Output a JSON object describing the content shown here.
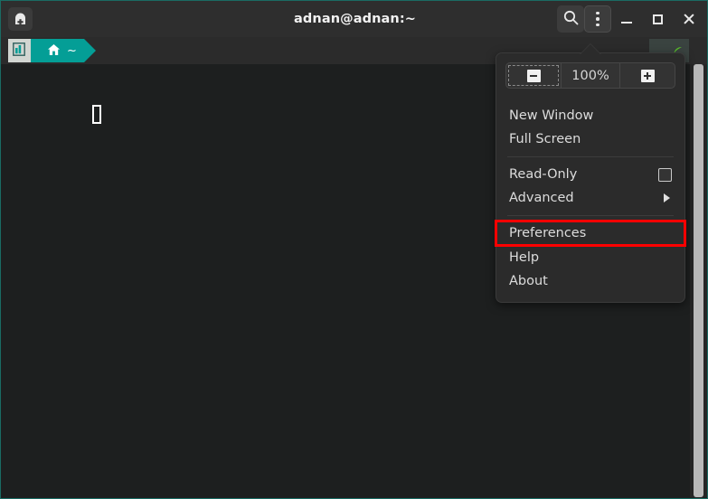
{
  "window": {
    "title": "adnan@adnan:~",
    "accent_border": "#1a6b63",
    "background": "#1d1f1f"
  },
  "titlebar": {
    "new_tab_button": "new-tab",
    "search_button": "search",
    "menu_button": "menu",
    "minimize_button": "minimize",
    "maximize_button": "maximize",
    "close_button": "close"
  },
  "tabbar": {
    "tab": {
      "icon": "chart-bars-icon",
      "home_icon": "home-icon",
      "label": "~"
    }
  },
  "terminal": {
    "prompt_text": "",
    "cursor": "block-cursor"
  },
  "menu": {
    "zoom": {
      "out_label": "zoom-out",
      "level": "100%",
      "in_label": "zoom-in"
    },
    "items": [
      {
        "label": "New Window",
        "type": "plain"
      },
      {
        "label": "Full Screen",
        "type": "plain"
      },
      {
        "label": "Read-Only",
        "type": "checkbox",
        "checked": false
      },
      {
        "label": "Advanced",
        "type": "submenu"
      },
      {
        "label": "Preferences",
        "type": "plain",
        "highlighted": true
      },
      {
        "label": "Help",
        "type": "plain"
      },
      {
        "label": "About",
        "type": "plain"
      }
    ],
    "highlight_color": "#ff0000"
  }
}
